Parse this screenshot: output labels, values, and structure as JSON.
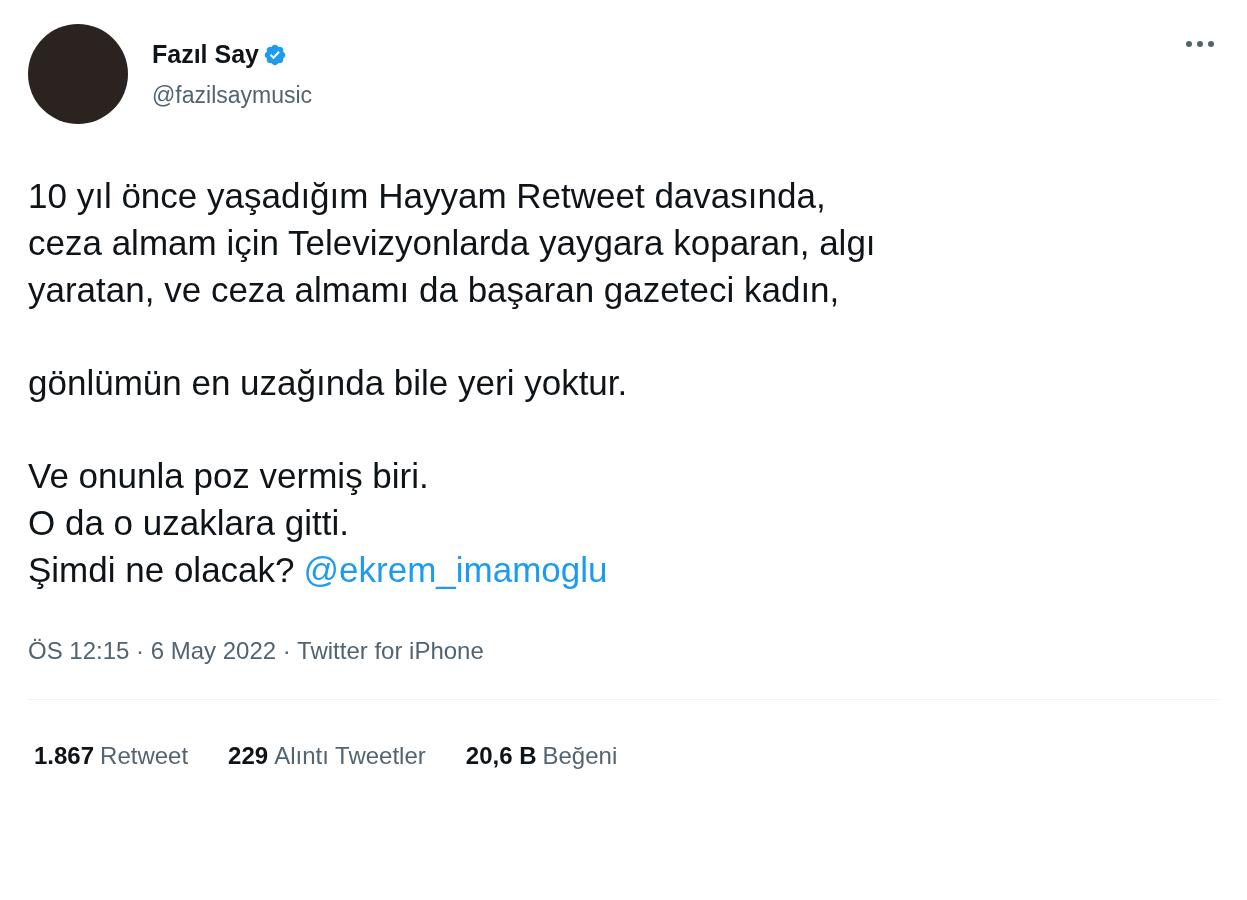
{
  "author": {
    "name": "Fazıl Say",
    "verified": true,
    "handle": "@fazilsaymusic"
  },
  "paragraphs": [
    {
      "lines": [
        {
          "text": "10 yıl önce yaşadığım Hayyam Retweet davasında,"
        },
        {
          "text": "ceza almam için Televizyonlarda yaygara koparan, algı"
        },
        {
          "text": "yaratan, ve ceza almamı da başaran gazeteci kadın,"
        }
      ]
    },
    {
      "lines": [
        {
          "text": "gönlümün en uzağında bile yeri yoktur."
        }
      ]
    },
    {
      "lines": [
        {
          "text": "Ve onunla poz vermiş biri."
        },
        {
          "text": "O da o uzaklara gitti."
        },
        {
          "text": "Şimdi ne olacak?",
          "mention": "@ekrem_imamoglu"
        }
      ]
    }
  ],
  "meta": "ÖS 12:15 · 6 May 2022 · Twitter for iPhone",
  "stats": [
    {
      "count": "1.867",
      "label": "Retweet"
    },
    {
      "count": "229",
      "label": "Alıntı Tweetler"
    },
    {
      "count": "20,6 B",
      "label": "Beğeni"
    }
  ]
}
